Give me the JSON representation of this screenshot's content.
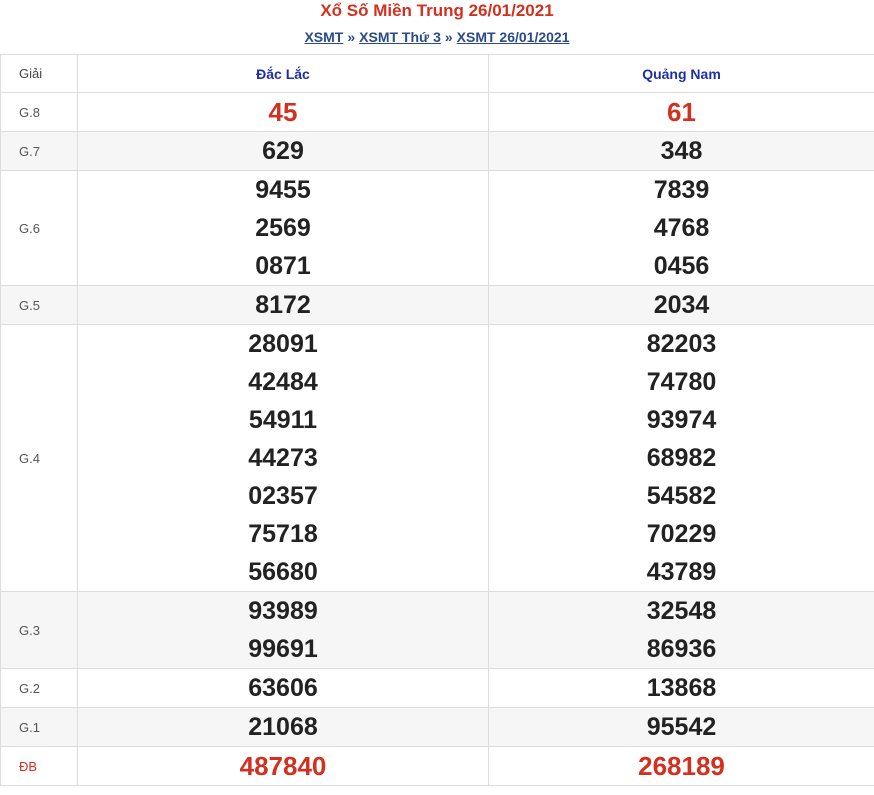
{
  "header": {
    "title": "Xổ Số Miền Trung 26/01/2021",
    "breadcrumb": [
      "XSMT",
      "XSMT Thứ 3",
      "XSMT 26/01/2021"
    ],
    "separator": "»"
  },
  "table": {
    "label_header": "Giải",
    "provinces": [
      "Đắc Lắc",
      "Quảng Nam"
    ],
    "rows": [
      {
        "label": "G.8",
        "d1": [
          "45"
        ],
        "d2": [
          "61"
        ]
      },
      {
        "label": "G.7",
        "d1": [
          "629"
        ],
        "d2": [
          "348"
        ]
      },
      {
        "label": "G.6",
        "d1": [
          "9455",
          "2569",
          "0871"
        ],
        "d2": [
          "7839",
          "4768",
          "0456"
        ]
      },
      {
        "label": "G.5",
        "d1": [
          "8172"
        ],
        "d2": [
          "2034"
        ]
      },
      {
        "label": "G.4",
        "d1": [
          "28091",
          "42484",
          "54911",
          "44273",
          "02357",
          "75718",
          "56680"
        ],
        "d2": [
          "82203",
          "74780",
          "93974",
          "68982",
          "54582",
          "70229",
          "43789"
        ]
      },
      {
        "label": "G.3",
        "d1": [
          "93989",
          "99691"
        ],
        "d2": [
          "32548",
          "86936"
        ]
      },
      {
        "label": "G.2",
        "d1": [
          "63606"
        ],
        "d2": [
          "13868"
        ]
      },
      {
        "label": "G.1",
        "d1": [
          "21068"
        ],
        "d2": [
          "95542"
        ]
      },
      {
        "label": "ĐB",
        "d1": [
          "487840"
        ],
        "d2": [
          "268189"
        ]
      }
    ]
  },
  "colors": {
    "accent": "#d4301f",
    "link": "#2a4a8a",
    "province": "#1f2fa8"
  }
}
